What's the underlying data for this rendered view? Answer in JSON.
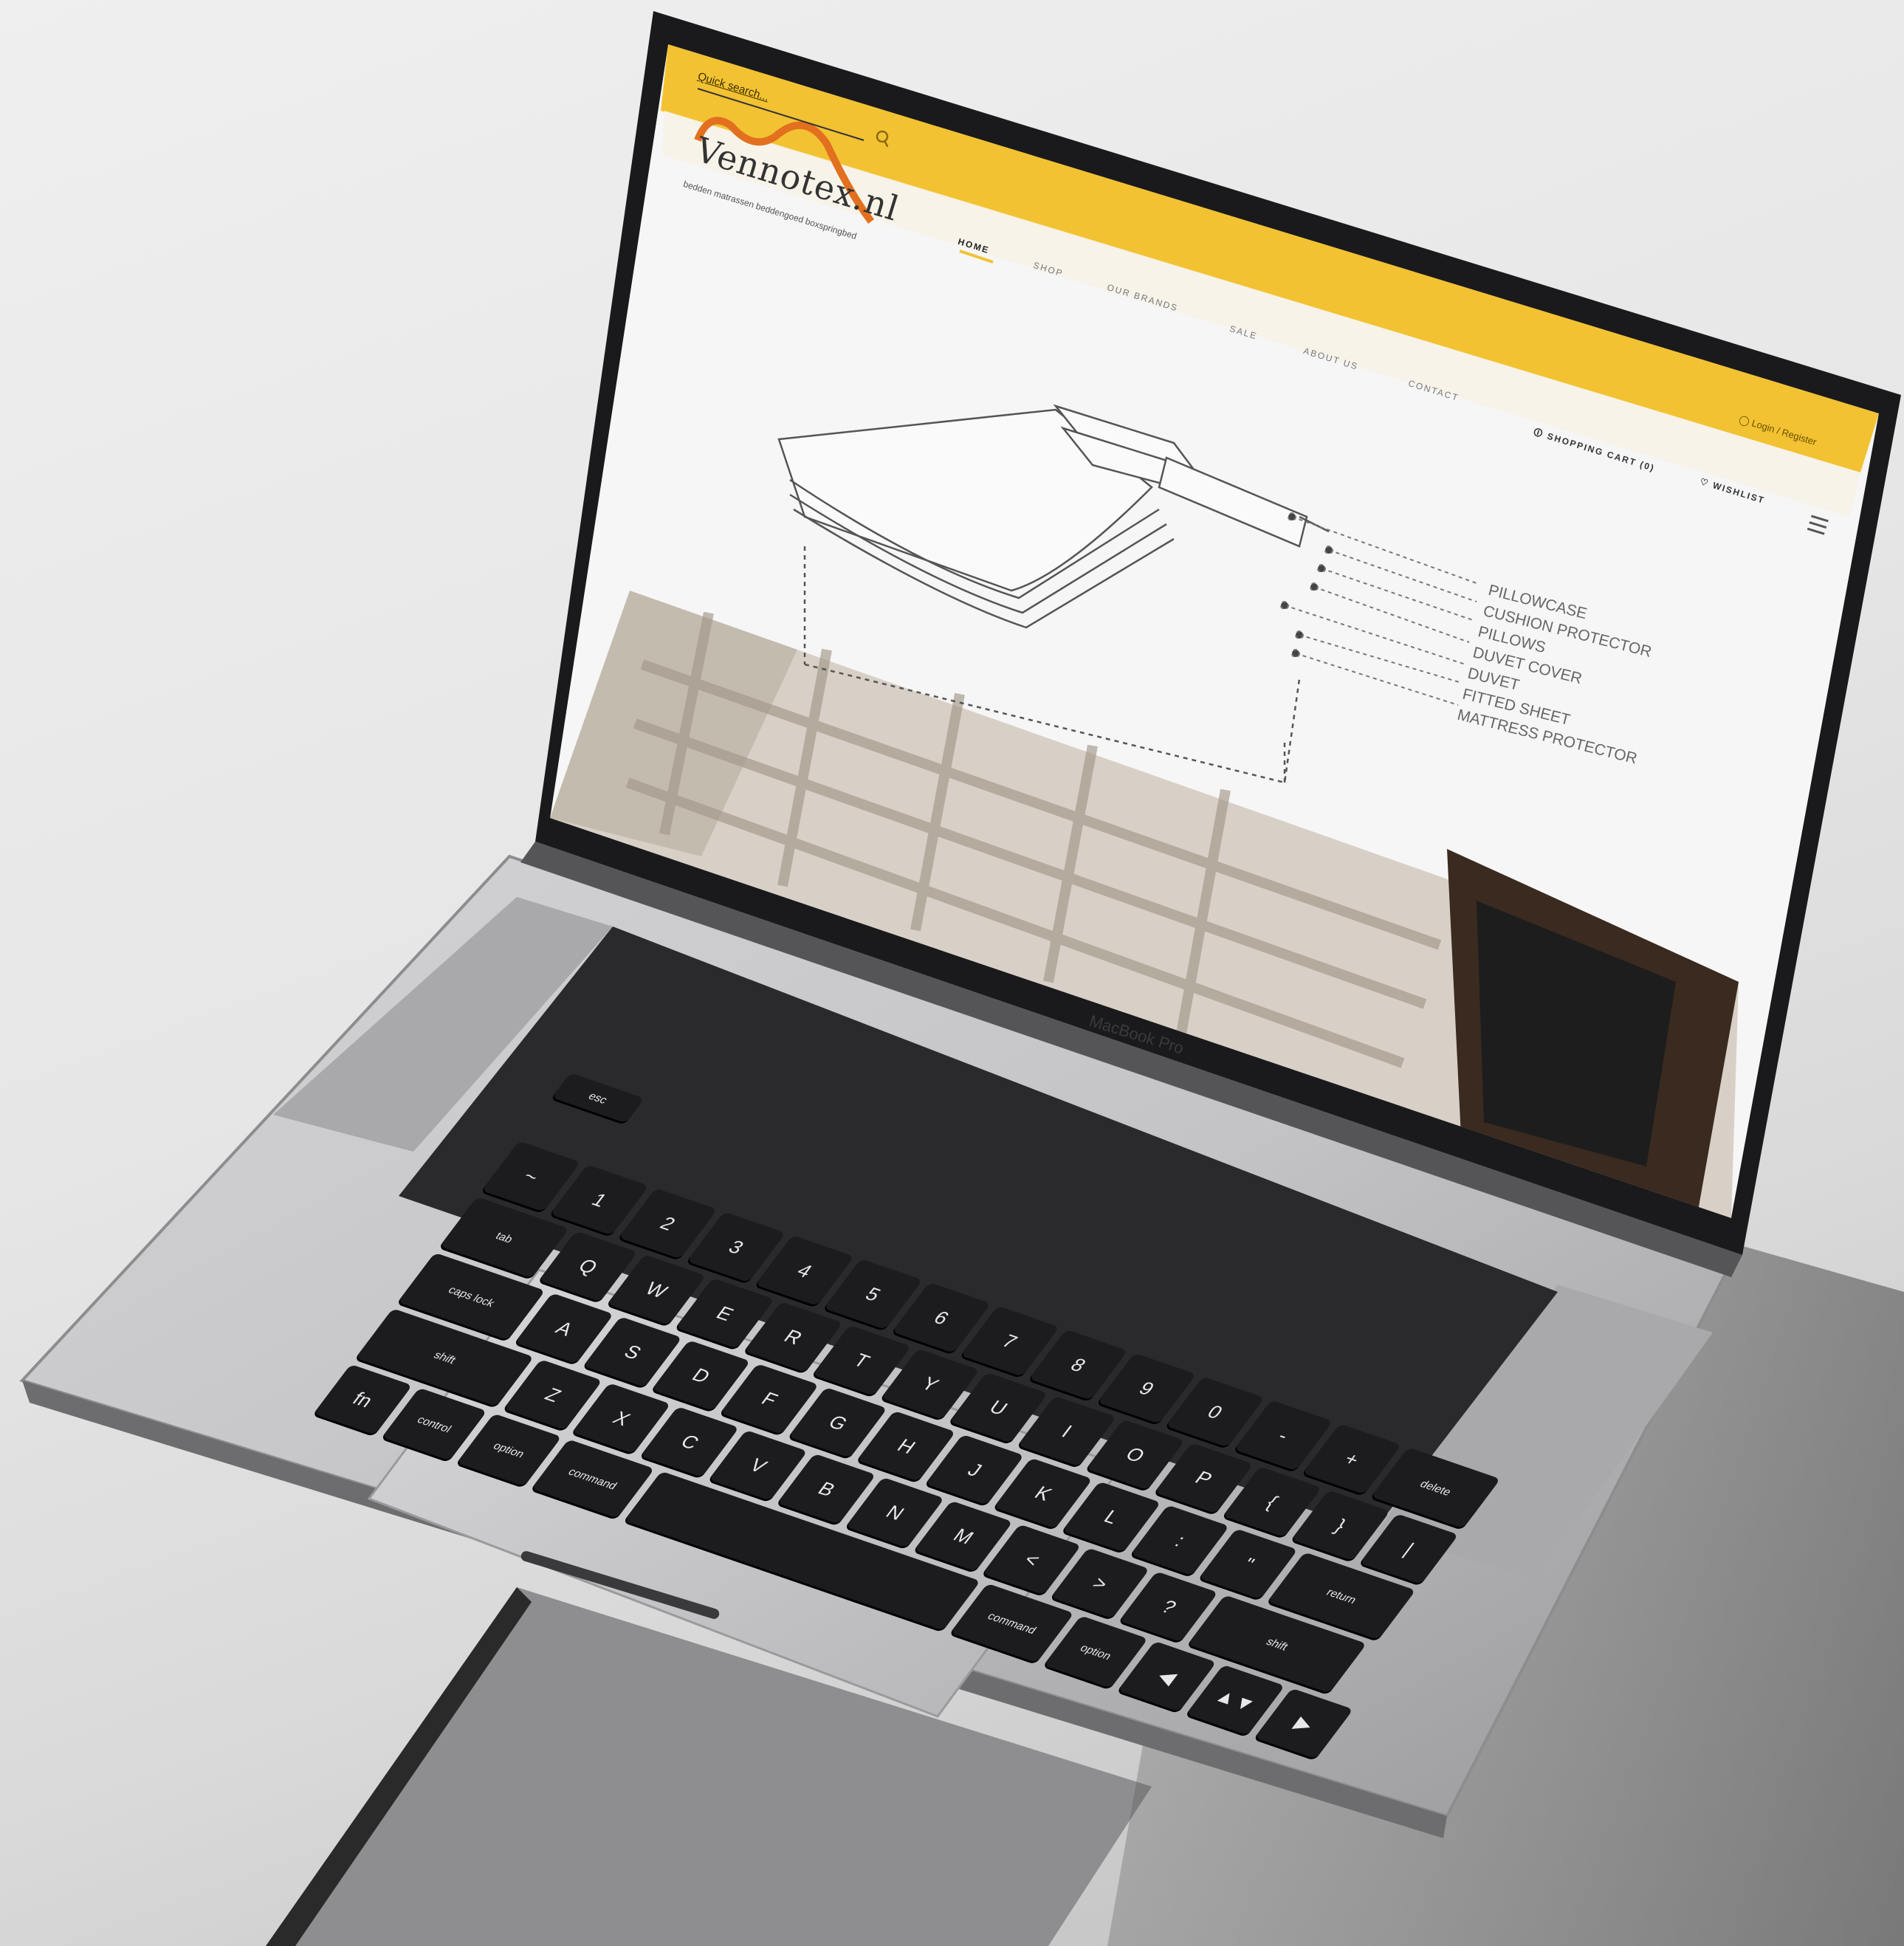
{
  "site": {
    "search_placeholder": "Quick search...",
    "logo_text": "Vennotex.nl",
    "logo_tagline": "bedden matrassen beddengoed boxspringbed",
    "nav": [
      "HOME",
      "SHOP",
      "OUR BRANDS",
      "SALE",
      "ABOUT US",
      "CONTACT"
    ],
    "login_label": "Login / Register",
    "cart_label": "SHOPPING CART (0)",
    "wishlist_label": "WISHLIST",
    "diagram_labels": [
      "PILLOWCASE",
      "CUSHION PROTECTOR",
      "PILLOWS",
      "DUVET COVER",
      "DUVET",
      "FITTED SHEET",
      "MATTRESS PROTECTOR"
    ]
  },
  "device": {
    "bezel_label": "MacBook Pro"
  },
  "keyboard": {
    "row0": [
      "esc"
    ],
    "row1": [
      "~",
      "1",
      "2",
      "3",
      "4",
      "5",
      "6",
      "7",
      "8",
      "9",
      "0",
      "-",
      "+",
      "delete"
    ],
    "row2": [
      "tab",
      "Q",
      "W",
      "E",
      "R",
      "T",
      "Y",
      "U",
      "I",
      "O",
      "P",
      "{",
      "}",
      "|"
    ],
    "row3": [
      "caps lock",
      "A",
      "S",
      "D",
      "F",
      "G",
      "H",
      "J",
      "K",
      "L",
      ":",
      "\"",
      "return"
    ],
    "row4": [
      "shift",
      "Z",
      "X",
      "C",
      "V",
      "B",
      "N",
      "M",
      "<",
      ">",
      "?",
      "shift"
    ],
    "row5": [
      "fn",
      "control",
      "option",
      "command",
      "",
      "command",
      "option",
      "◀",
      "▲▼",
      "▶"
    ]
  },
  "colors": {
    "accent": "#f2c232",
    "logo_orange": "#e2701f",
    "key": "#1c1c1e",
    "body_silver": "#c9c9cb"
  }
}
